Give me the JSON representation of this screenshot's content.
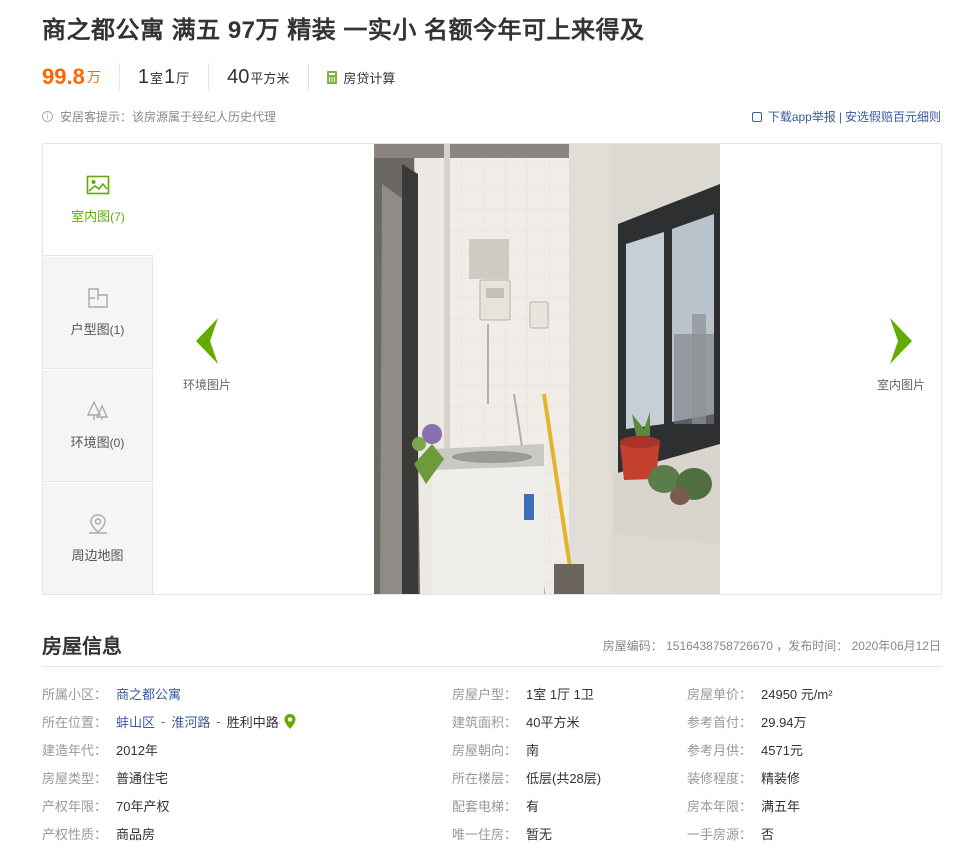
{
  "title": "商之都公寓 满五 97万 精装 一实小 名额今年可上来得及",
  "summary": {
    "price": "99.8",
    "price_unit": "万",
    "room_num": "1",
    "room_unit": "室",
    "hall_num": "1",
    "hall_unit": "厅",
    "area_num": "40",
    "area_unit": "平方米",
    "loan_calc": "房贷计算"
  },
  "tip": {
    "text": "安居客提示：该房源属于经纪人历史代理",
    "download": "下载app举报",
    "divider": "|",
    "guarantee": "安选假赔百元细则"
  },
  "gallery": {
    "tabs": [
      {
        "label": "室内图",
        "count": "(7)",
        "icon": "image-icon"
      },
      {
        "label": "户型图",
        "count": "(1)",
        "icon": "floorplan-icon"
      },
      {
        "label": "环境图",
        "count": "(0)",
        "icon": "trees-icon"
      },
      {
        "label": "周边地图",
        "count": "",
        "icon": "location-pin-icon"
      }
    ],
    "prev_label": "环境图片",
    "next_label": "室内图片"
  },
  "house_info": {
    "title": "房屋信息",
    "code_label": "房屋编码：",
    "code": "1516438758726670",
    "publish_label": "，发布时间：",
    "publish_date": "2020年06月12日",
    "rows": [
      [
        {
          "label": "所属小区：",
          "value": "商之都公寓",
          "link": true
        },
        {
          "label": "房屋户型：",
          "value": "1室 1厅 1卫"
        },
        {
          "label": "房屋单价：",
          "value": "24950 元/m²"
        }
      ],
      [
        {
          "label": "所在位置：",
          "location": [
            "蚌山区",
            "淮河路",
            "胜利中路"
          ]
        },
        {
          "label": "建筑面积：",
          "value": "40平方米"
        },
        {
          "label": "参考首付：",
          "value": "29.94万"
        }
      ],
      [
        {
          "label": "建造年代：",
          "value": "2012年"
        },
        {
          "label": "房屋朝向：",
          "value": "南"
        },
        {
          "label": "参考月供：",
          "value": "4571元"
        }
      ],
      [
        {
          "label": "房屋类型：",
          "value": "普通住宅"
        },
        {
          "label": "所在楼层：",
          "value": "低层(共28层)"
        },
        {
          "label": "装修程度：",
          "value": "精装修"
        }
      ],
      [
        {
          "label": "产权年限：",
          "value": "70年产权"
        },
        {
          "label": "配套电梯：",
          "value": "有"
        },
        {
          "label": "房本年限：",
          "value": "满五年"
        }
      ],
      [
        {
          "label": "产权性质：",
          "value": "商品房"
        },
        {
          "label": "唯一住房：",
          "value": "暂无"
        },
        {
          "label": "一手房源：",
          "value": "否"
        }
      ]
    ]
  },
  "colors": {
    "price": "#ff6600",
    "accent_green": "#62ab00",
    "link_blue": "#3a5a9a"
  }
}
